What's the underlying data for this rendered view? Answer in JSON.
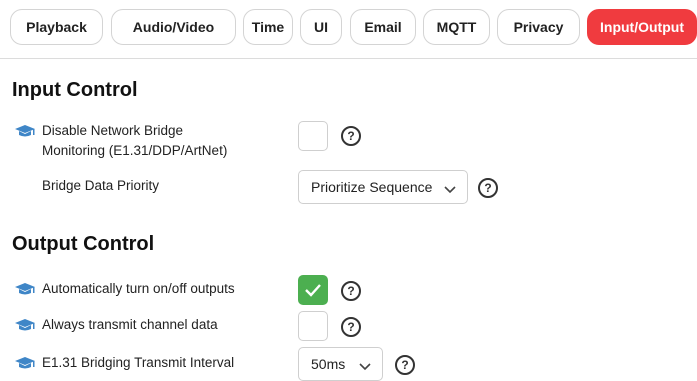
{
  "tabs": [
    "Playback",
    "Audio/Video",
    "Time",
    "UI",
    "Email",
    "MQTT",
    "Privacy",
    "Input/Output"
  ],
  "active_tab": "Input/Output",
  "accent_color": "#f03b3f",
  "checked_color": "#4caf50",
  "info_icon_color": "#3f86c7",
  "input_control": {
    "heading": "Input Control",
    "disable_bridge_label_line1": "Disable Network Bridge",
    "disable_bridge_label_line2": "Monitoring (E1.31/DDP/ArtNet)",
    "disable_bridge_checked": false,
    "bridge_priority_label": "Bridge Data Priority",
    "bridge_priority_value": "Prioritize Sequence"
  },
  "output_control": {
    "heading": "Output Control",
    "auto_outputs_label": "Automatically turn on/off outputs",
    "auto_outputs_checked": true,
    "always_transmit_label": "Always transmit channel data",
    "always_transmit_checked": false,
    "bridging_interval_label": "E1.31 Bridging Transmit Interval",
    "bridging_interval_value": "50ms"
  },
  "help_glyph": "?",
  "icons": {
    "row_icon": "graduation-cap-icon",
    "help_icon": "question-circle-icon",
    "dropdown_icon": "chevron-down-icon",
    "check_icon": "checkmark-icon"
  }
}
